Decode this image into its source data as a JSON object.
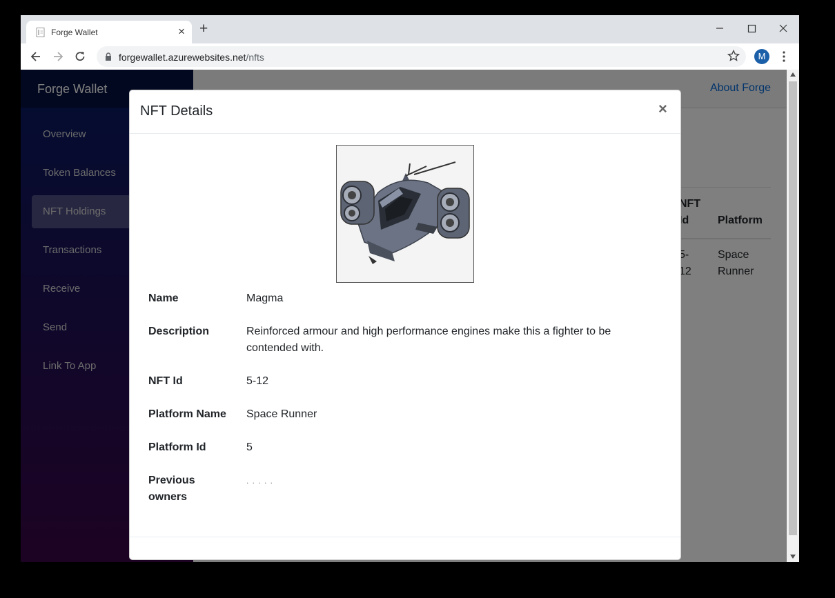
{
  "browser": {
    "tab_title": "Forge Wallet",
    "url_host": "forgewallet.azurewebsites.net",
    "url_path": "/nfts",
    "profile_initial": "M"
  },
  "sidebar": {
    "brand": "Forge Wallet",
    "items": [
      {
        "label": "Overview",
        "active": false
      },
      {
        "label": "Token Balances",
        "active": false
      },
      {
        "label": "NFT Holdings",
        "active": true
      },
      {
        "label": "Transactions",
        "active": false
      },
      {
        "label": "Receive",
        "active": false
      },
      {
        "label": "Send",
        "active": false
      },
      {
        "label": "Link To App",
        "active": false
      }
    ]
  },
  "topbar": {
    "about_link": "About Forge"
  },
  "table": {
    "headers": {
      "nft_id_l1": "NFT",
      "nft_id_l2": "Id",
      "platform": "Platform"
    },
    "row": {
      "nft_id_l1": "5-",
      "nft_id_l2": "12",
      "platform_l1": "Space",
      "platform_l2": "Runner"
    }
  },
  "modal": {
    "title": "NFT Details",
    "close_glyph": "×",
    "image_icon": "spaceship-image",
    "fields": [
      {
        "label": "Name",
        "value": "Magma"
      },
      {
        "label": "Description",
        "value": "Reinforced armour and high performance engines make this a fighter to be contended with."
      },
      {
        "label": "NFT Id",
        "value": "5-12"
      },
      {
        "label": "Platform Name",
        "value": "Space Runner"
      },
      {
        "label": "Platform Id",
        "value": "5"
      },
      {
        "label": "Previous owners",
        "value": ". . . . ."
      }
    ]
  },
  "colors": {
    "sidebar_top": "#051a63",
    "sidebar_bottom": "#3a0647",
    "link": "#0366d6",
    "avatar": "#1a5fa8"
  }
}
